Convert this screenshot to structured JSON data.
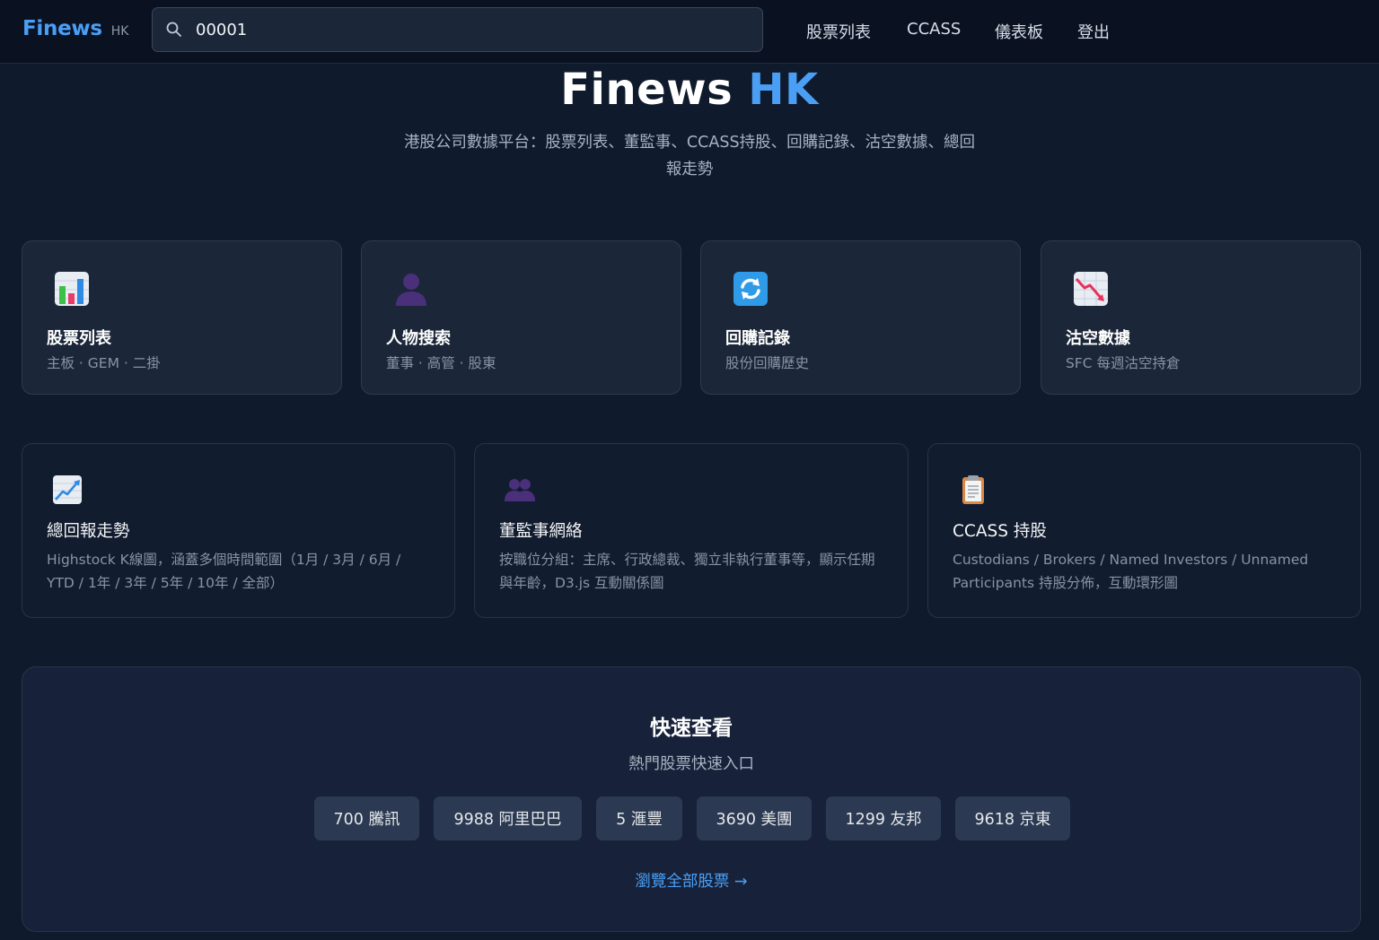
{
  "brand": {
    "name": "Finews",
    "region": "HK"
  },
  "search": {
    "value": "00001",
    "placeholder": ""
  },
  "nav": [
    "股票列表",
    "CCASS",
    "儀表板",
    "登出"
  ],
  "hero": {
    "title_main": "Finews",
    "title_accent": "HK",
    "subtitle_line1": "港股公司數據平台：股票列表、董監事、CCASS持股、回購記錄、沽空數據、總回",
    "subtitle_line2": "報走勢"
  },
  "feature_cards": [
    {
      "icon": "bar-chart-icon",
      "title": "股票列表",
      "desc": "主板 · GEM · 二掛"
    },
    {
      "icon": "person-silhouette-icon",
      "title": "人物搜索",
      "desc": "董事 · 高管 · 股東"
    },
    {
      "icon": "refresh-arrows-icon",
      "title": "回購記錄",
      "desc": "股份回購歷史"
    },
    {
      "icon": "chart-decreasing-icon",
      "title": "沽空數據",
      "desc": "SFC 每週沽空持倉"
    }
  ],
  "detail_cards": [
    {
      "icon": "chart-increasing-icon",
      "title": "總回報走勢",
      "desc": "Highstock K線圖，涵蓋多個時間範圍（1月 / 3月 / 6月 / YTD / 1年 / 3年 / 5年 / 10年 / 全部）"
    },
    {
      "icon": "people-silhouette-icon",
      "title": "董監事網絡",
      "desc": "按職位分組：主席、行政總裁、獨立非執行董事等，顯示任期與年齡，D3.js 互動關係圖"
    },
    {
      "icon": "clipboard-icon",
      "title": "CCASS 持股",
      "desc": "Custodians / Brokers / Named Investors / Unnamed Participants 持股分佈，互動環形圖"
    }
  ],
  "quick": {
    "title": "快速查看",
    "subtitle": "熱門股票快速入口",
    "chips": [
      "700 騰訊",
      "9988 阿里巴巴",
      "5 滙豐",
      "3690 美團",
      "1299 友邦",
      "9618 京東"
    ],
    "browse_all": "瀏覽全部股票 →"
  }
}
